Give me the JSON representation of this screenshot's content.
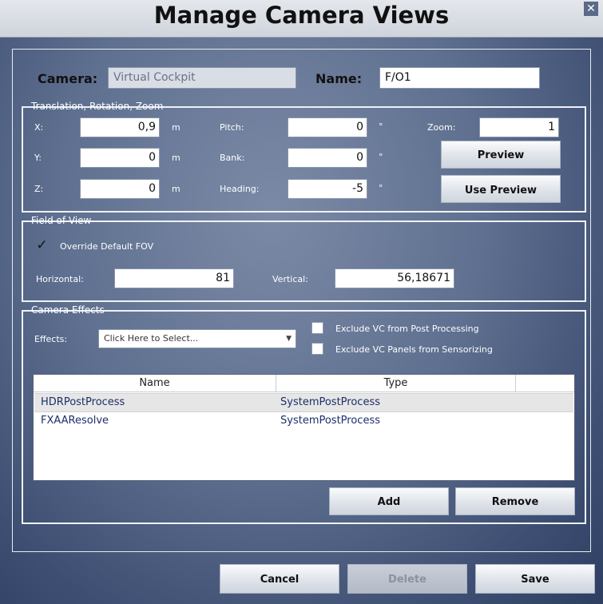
{
  "window": {
    "title": "Manage Camera Views",
    "close_glyph": "✕"
  },
  "camera": {
    "label": "Camera:",
    "value": "Virtual Cockpit"
  },
  "name": {
    "label": "Name:",
    "value": "F/O1"
  },
  "translation_group": {
    "title": "Translation, Rotation, Zoom",
    "x_label": "X:",
    "x_value": "0,9",
    "x_unit": "m",
    "y_label": "Y:",
    "y_value": "0",
    "y_unit": "m",
    "z_label": "Z:",
    "z_value": "0",
    "z_unit": "m",
    "pitch_label": "Pitch:",
    "pitch_value": "0",
    "pitch_unit": "°",
    "bank_label": "Bank:",
    "bank_value": "0",
    "bank_unit": "°",
    "heading_label": "Heading:",
    "heading_value": "-5",
    "heading_unit": "°",
    "zoom_label": "Zoom:",
    "zoom_value": "1",
    "preview_button": "Preview",
    "use_preview_button": "Use Preview"
  },
  "fov_group": {
    "title": "Field of View",
    "override_label": "Override Default FOV",
    "override_checked": "✓",
    "horizontal_label": "Horizontal:",
    "horizontal_value": "81",
    "vertical_label": "Vertical:",
    "vertical_value": "56,18671"
  },
  "effects_group": {
    "title": "Camera Effects",
    "effects_label": "Effects:",
    "effects_select_value": "Click Here to Select...",
    "exclude_post_label": "Exclude VC from Post Processing",
    "exclude_panels_label": "Exclude VC Panels from Sensorizing",
    "table": {
      "columns": [
        "Name",
        "Type"
      ],
      "rows": [
        {
          "name": "HDRPostProcess",
          "type": "SystemPostProcess"
        },
        {
          "name": "FXAAResolve",
          "type": "SystemPostProcess"
        }
      ]
    },
    "add_button": "Add",
    "remove_button": "Remove"
  },
  "footer": {
    "cancel_button": "Cancel",
    "delete_button": "Delete",
    "save_button": "Save"
  }
}
